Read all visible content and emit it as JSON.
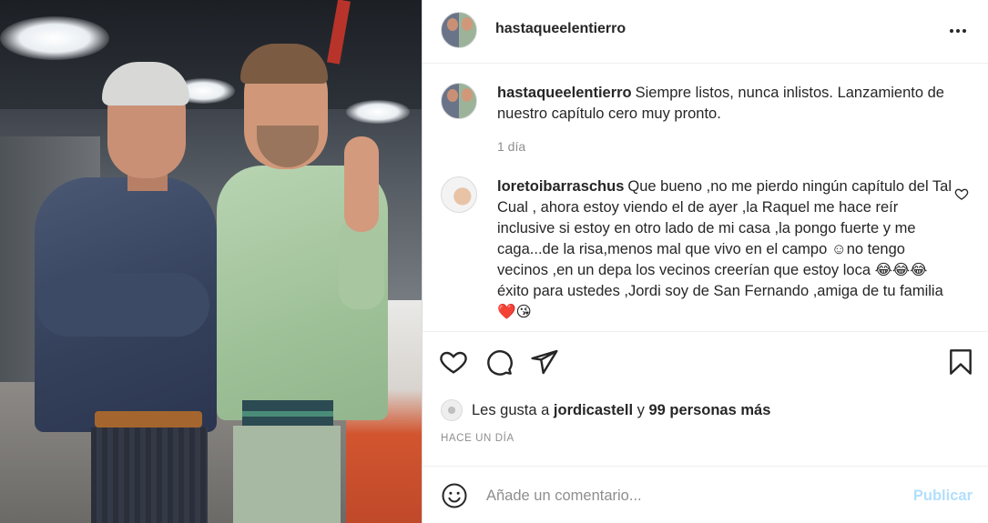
{
  "post": {
    "username": "hastaqueelentierro"
  },
  "caption": {
    "username": "hastaqueelentierro",
    "text": "Siempre listos, nunca inlistos. Lanzamiento de nuestro capítulo cero muy pronto.",
    "time": "1 día"
  },
  "comment": {
    "username": "loretoibarraschus",
    "text": "Que bueno ,no me pierdo ningún capítulo del Tal Cual , ahora estoy viendo el de ayer ,la Raquel me hace reír inclusive si estoy en otro lado de mi casa ,la pongo fuerte y me caga...de la risa,menos mal que vivo en el campo ☺no tengo vecinos ,en un depa los vecinos creerían que estoy loca 😂😂😂 éxito para ustedes ,Jordi soy de San Fernando ,amiga de tu familia ❤️😘"
  },
  "likes": {
    "prefix": "Les gusta a",
    "user": "jordicastell",
    "middle": "y",
    "others": "99 personas más"
  },
  "timeago": "HACE UN DÍA",
  "add_comment": {
    "placeholder": "Añade un comentario...",
    "publish_label": "Publicar"
  },
  "icons": {
    "like": "heart-icon",
    "comment": "comment-icon",
    "share": "paper-plane-icon",
    "save": "bookmark-icon",
    "more": "more-options-icon",
    "emoji": "emoji-icon",
    "comment_like": "heart-icon"
  },
  "colors": {
    "publish_disabled": "#b2dffc",
    "secondary_text": "#8e8e8e",
    "border": "#dbdbdb"
  }
}
